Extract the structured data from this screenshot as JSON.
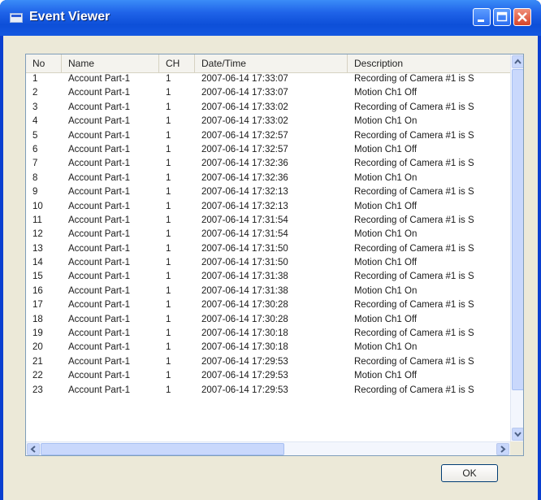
{
  "window": {
    "title": "Event Viewer",
    "icons": {
      "app": "event-viewer-icon",
      "minimize": "minimize-icon",
      "maximize": "maximize-icon",
      "close": "close-icon"
    }
  },
  "table": {
    "columns": [
      "No",
      "Name",
      "CH",
      "Date/Time",
      "Description"
    ],
    "rows": [
      [
        "1",
        "Account Part-1",
        "1",
        "2007-06-14 17:33:07",
        "Recording of Camera #1 is S"
      ],
      [
        "2",
        "Account Part-1",
        "1",
        "2007-06-14 17:33:07",
        "Motion Ch1 Off"
      ],
      [
        "3",
        "Account Part-1",
        "1",
        "2007-06-14 17:33:02",
        "Recording of Camera #1 is S"
      ],
      [
        "4",
        "Account Part-1",
        "1",
        "2007-06-14 17:33:02",
        "Motion Ch1 On"
      ],
      [
        "5",
        "Account Part-1",
        "1",
        "2007-06-14 17:32:57",
        "Recording of Camera #1 is S"
      ],
      [
        "6",
        "Account Part-1",
        "1",
        "2007-06-14 17:32:57",
        "Motion Ch1 Off"
      ],
      [
        "7",
        "Account Part-1",
        "1",
        "2007-06-14 17:32:36",
        "Recording of Camera #1 is S"
      ],
      [
        "8",
        "Account Part-1",
        "1",
        "2007-06-14 17:32:36",
        "Motion Ch1 On"
      ],
      [
        "9",
        "Account Part-1",
        "1",
        "2007-06-14 17:32:13",
        "Recording of Camera #1 is S"
      ],
      [
        "10",
        "Account Part-1",
        "1",
        "2007-06-14 17:32:13",
        "Motion Ch1 Off"
      ],
      [
        "11",
        "Account Part-1",
        "1",
        "2007-06-14 17:31:54",
        "Recording of Camera #1 is S"
      ],
      [
        "12",
        "Account Part-1",
        "1",
        "2007-06-14 17:31:54",
        "Motion Ch1 On"
      ],
      [
        "13",
        "Account Part-1",
        "1",
        "2007-06-14 17:31:50",
        "Recording of Camera #1 is S"
      ],
      [
        "14",
        "Account Part-1",
        "1",
        "2007-06-14 17:31:50",
        "Motion Ch1 Off"
      ],
      [
        "15",
        "Account Part-1",
        "1",
        "2007-06-14 17:31:38",
        "Recording of Camera #1 is S"
      ],
      [
        "16",
        "Account Part-1",
        "1",
        "2007-06-14 17:31:38",
        "Motion Ch1 On"
      ],
      [
        "17",
        "Account Part-1",
        "1",
        "2007-06-14 17:30:28",
        "Recording of Camera #1 is S"
      ],
      [
        "18",
        "Account Part-1",
        "1",
        "2007-06-14 17:30:28",
        "Motion Ch1 Off"
      ],
      [
        "19",
        "Account Part-1",
        "1",
        "2007-06-14 17:30:18",
        "Recording of Camera #1 is S"
      ],
      [
        "20",
        "Account Part-1",
        "1",
        "2007-06-14 17:30:18",
        "Motion Ch1 On"
      ],
      [
        "21",
        "Account Part-1",
        "1",
        "2007-06-14 17:29:53",
        "Recording of Camera #1 is S"
      ],
      [
        "22",
        "Account Part-1",
        "1",
        "2007-06-14 17:29:53",
        "Motion Ch1 Off"
      ],
      [
        "23",
        "Account Part-1",
        "1",
        "2007-06-14 17:29:53",
        "Recording of Camera #1 is S"
      ]
    ]
  },
  "buttons": {
    "ok": "OK"
  },
  "colors": {
    "titlebar": "#1f63e8",
    "dialog_bg": "#ece9d8",
    "scrollbar": "#c9d8fc"
  }
}
